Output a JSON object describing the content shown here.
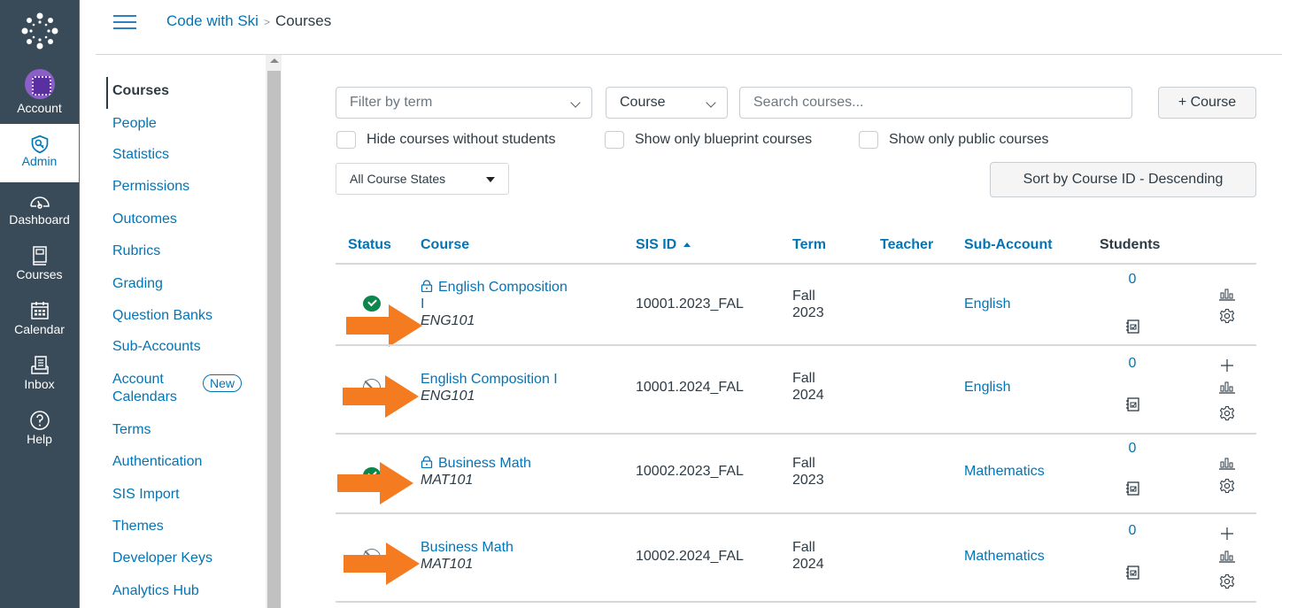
{
  "global_nav": {
    "items": [
      {
        "label": "Account",
        "icon": "avatar-icon"
      },
      {
        "label": "Admin",
        "icon": "shield-key-icon",
        "active": true
      },
      {
        "label": "Dashboard",
        "icon": "speedometer-icon"
      },
      {
        "label": "Courses",
        "icon": "book-icon"
      },
      {
        "label": "Calendar",
        "icon": "calendar-icon"
      },
      {
        "label": "Inbox",
        "icon": "inbox-icon"
      },
      {
        "label": "Help",
        "icon": "question-icon"
      }
    ],
    "colors": {
      "bg": "#394b58",
      "active_text": "#0374b5"
    }
  },
  "header": {
    "breadcrumb": [
      {
        "label": "Code with Ski"
      },
      {
        "label": "Courses"
      }
    ],
    "separator": ">"
  },
  "subnav": {
    "items": [
      {
        "label": "Courses",
        "active": true
      },
      {
        "label": "People"
      },
      {
        "label": "Statistics"
      },
      {
        "label": "Permissions"
      },
      {
        "label": "Outcomes"
      },
      {
        "label": "Rubrics"
      },
      {
        "label": "Grading"
      },
      {
        "label": "Question Banks"
      },
      {
        "label": "Sub-Accounts"
      },
      {
        "label": "Account\nCalendars",
        "line1": "Account",
        "line2": "Calendars",
        "badge": "New"
      },
      {
        "label": "Terms"
      },
      {
        "label": "Authentication"
      },
      {
        "label": "SIS Import"
      },
      {
        "label": "Themes"
      },
      {
        "label": "Developer Keys"
      },
      {
        "label": "Analytics Hub"
      }
    ]
  },
  "filters": {
    "term_select": {
      "placeholder": "Filter by term"
    },
    "search_by_select": {
      "value": "Course"
    },
    "search": {
      "placeholder": "Search courses...",
      "value": ""
    },
    "add_course_label": "+ Course",
    "checkboxes": [
      {
        "label": "Hide courses without students",
        "checked": false
      },
      {
        "label": "Show only blueprint courses",
        "checked": false
      },
      {
        "label": "Show only public courses",
        "checked": false
      }
    ],
    "course_states": {
      "value": "All Course States"
    },
    "sort_button_label": "Sort by Course ID - Descending"
  },
  "table": {
    "columns": [
      "Status",
      "Course",
      "SIS ID",
      "Term",
      "Teacher",
      "Sub-Account",
      "Students"
    ],
    "sorted_column": "SIS ID",
    "sort_direction": "ascending",
    "rows": [
      {
        "status": "published",
        "locked": true,
        "name": "English Composition I",
        "name_l1": "English Composition",
        "name_l2": "I",
        "code": "ENG101",
        "sis_id": "10001.2023_FAL",
        "term_l1": "Fall",
        "term_l2": "2023",
        "teacher": "",
        "sub_account": "English",
        "students": "0",
        "actions": [
          "statistics",
          "settings"
        ],
        "arrow": true
      },
      {
        "status": "unpublished",
        "locked": false,
        "name": "English Composition I",
        "code": "ENG101",
        "sis_id": "10001.2024_FAL",
        "term_l1": "Fall",
        "term_l2": "2024",
        "teacher": "",
        "sub_account": "English",
        "students": "0",
        "actions": [
          "add-user",
          "statistics",
          "settings"
        ],
        "arrow": true
      },
      {
        "status": "published",
        "locked": true,
        "name": "Business Math",
        "code": "MAT101",
        "sis_id": "10002.2023_FAL",
        "term_l1": "Fall",
        "term_l2": "2023",
        "teacher": "",
        "sub_account": "Mathematics",
        "students": "0",
        "actions": [
          "statistics",
          "settings"
        ],
        "arrow": true
      },
      {
        "status": "unpublished",
        "locked": false,
        "name": "Business Math",
        "code": "MAT101",
        "sis_id": "10002.2024_FAL",
        "term_l1": "Fall",
        "term_l2": "2024",
        "teacher": "",
        "sub_account": "Mathematics",
        "students": "0",
        "actions": [
          "add-user",
          "statistics",
          "settings"
        ],
        "arrow": true
      }
    ]
  },
  "colors": {
    "link": "#0374b5",
    "text": "#2d3b45",
    "published": "#0b874b",
    "annotation_arrow": "#f47b20"
  }
}
